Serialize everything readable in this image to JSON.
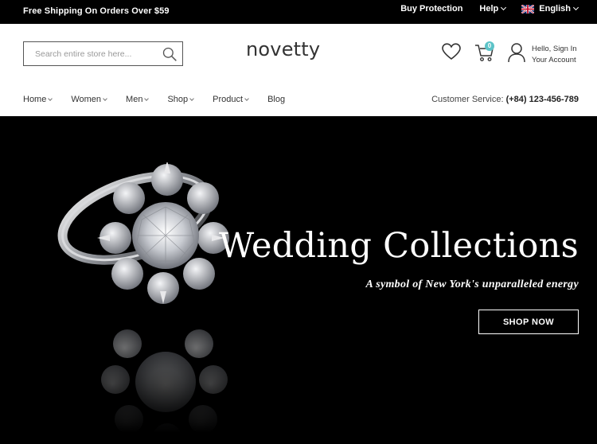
{
  "topbar": {
    "promo": "Free Shipping On Orders Over $59",
    "buy_protection": "Buy Protection",
    "help": "Help",
    "language": "English"
  },
  "header": {
    "search_placeholder": "Search entire store here...",
    "logo": "novetty",
    "cart_count": "0",
    "account_line1": "Hello, Sign In",
    "account_line2": "Your Account"
  },
  "nav": {
    "items": [
      {
        "label": "Home"
      },
      {
        "label": "Women"
      },
      {
        "label": "Men"
      },
      {
        "label": "Shop"
      },
      {
        "label": "Product"
      },
      {
        "label": "Blog"
      }
    ],
    "service_label": "Customer Service:",
    "service_phone": "(+84) 123-456-789"
  },
  "hero": {
    "title": "Wedding Collections",
    "subtitle": "A symbol of New York's unparalleled energy",
    "button": "SHOP NOW"
  },
  "colors": {
    "topbar_bg": "#000000",
    "hero_bg": "#000000",
    "badge": "#5cc3c8"
  }
}
